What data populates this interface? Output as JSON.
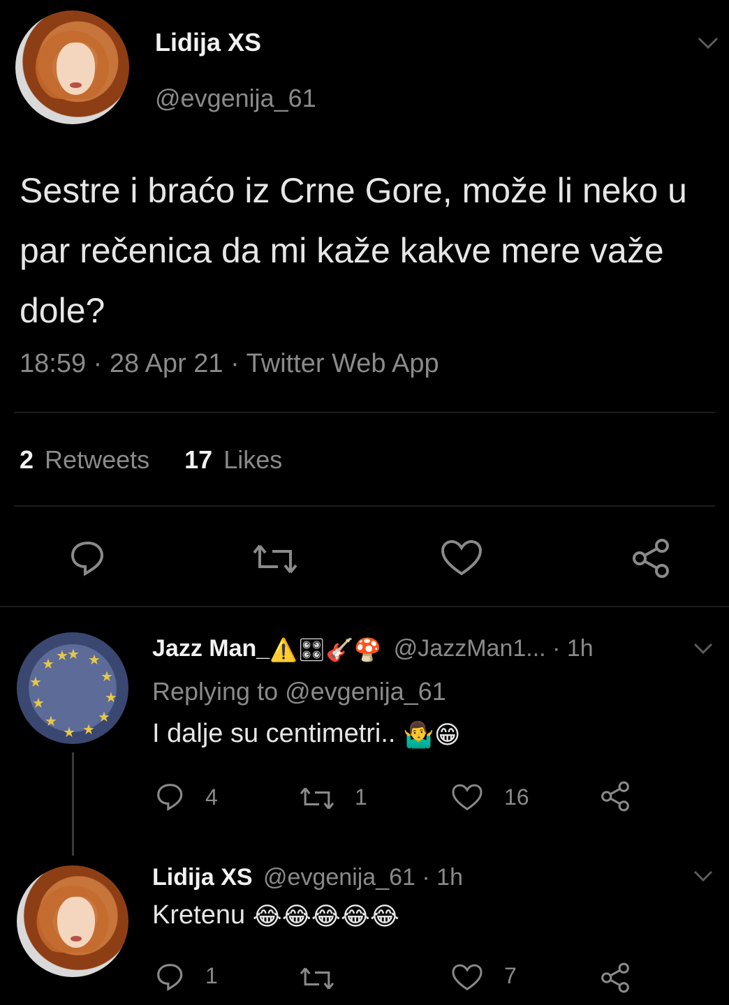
{
  "tweet": {
    "author_name": "Lidija XS",
    "author_handle": "@evgenija_61",
    "text": "Sestre i braćo iz Crne Gore, može li neko u par rečenica da mi kaže kakve mere važe dole?",
    "meta": "18:59 · 28 Apr 21 · Twitter Web App",
    "retweets_count": "2",
    "retweets_label": "Retweets",
    "likes_count": "17",
    "likes_label": "Likes"
  },
  "replies": [
    {
      "author_name": "Jazz Man_",
      "author_name_emojis": "⚠️🎛🎸🍄",
      "author_handle": "@JazzMan1...",
      "time": "· 1h",
      "replying_to": "Replying to @evgenija_61",
      "text": "I dalje su centimetri..",
      "text_emojis": "🤷‍♂️😁",
      "reply_count": "4",
      "retweet_count": "1",
      "like_count": "16"
    },
    {
      "author_name": "Lidija XS",
      "author_handle": "@evgenija_61",
      "time": "· 1h",
      "text": "Kretenu",
      "text_emojis": "😂😂😂😂😂",
      "reply_count": "1",
      "retweet_count": "",
      "like_count": "7"
    }
  ],
  "icons": {
    "reply": "reply-icon",
    "retweet": "retweet-icon",
    "like": "heart-icon",
    "share": "share-icon",
    "caret": "chevron-down-icon"
  },
  "colors": {
    "background": "#000000",
    "primary_text": "#d9d9d9",
    "secondary_text": "#8a8a8a",
    "divider": "#1d1d1d"
  }
}
